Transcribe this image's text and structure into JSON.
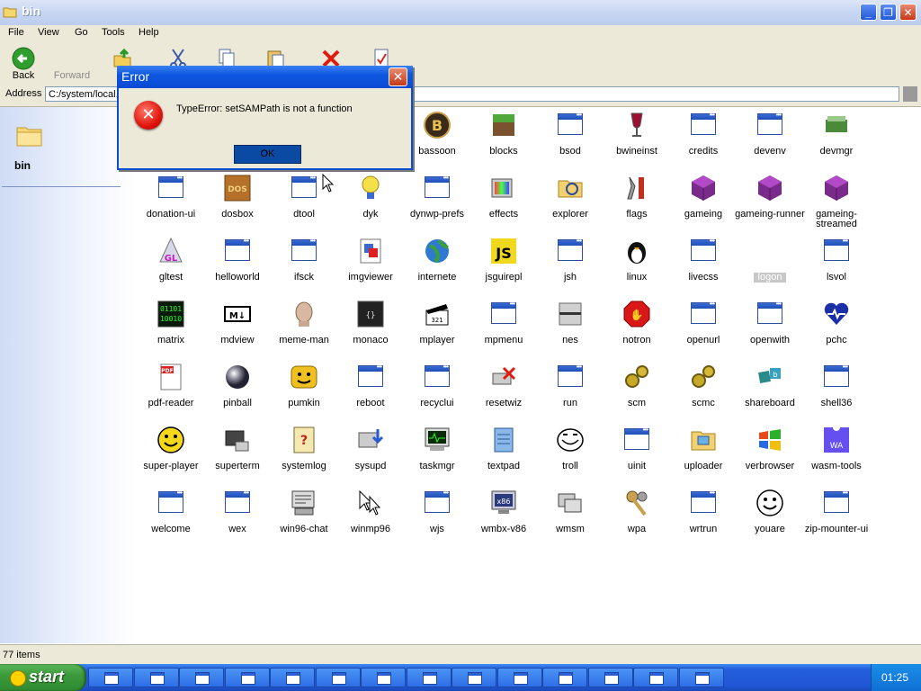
{
  "window": {
    "title": "bin",
    "controls": [
      "minimize",
      "restore",
      "close"
    ]
  },
  "menu": [
    "File",
    "View",
    "Go",
    "Tools",
    "Help"
  ],
  "toolbar": {
    "back_label": "Back",
    "forward_label": "Forward"
  },
  "address": {
    "label": "Address",
    "value": "C:/system/local."
  },
  "sidebar": {
    "folder_name": "bin"
  },
  "icons": [
    {
      "name": "bassoon",
      "icon": "bassoon-icon"
    },
    {
      "name": "blocks",
      "icon": "blocks-icon"
    },
    {
      "name": "bsod",
      "icon": "window-icon"
    },
    {
      "name": "bwineinst",
      "icon": "wine-glass-icon"
    },
    {
      "name": "credits",
      "icon": "window-icon"
    },
    {
      "name": "devenv",
      "icon": "window-icon"
    },
    {
      "name": "devmgr",
      "icon": "device-manager-icon"
    },
    {
      "name": "donation-ui",
      "icon": "window-icon"
    },
    {
      "name": "dosbox",
      "icon": "dosbox-icon"
    },
    {
      "name": "dtool",
      "icon": "window-icon"
    },
    {
      "name": "dyk",
      "icon": "lightbulb-icon"
    },
    {
      "name": "dynwp-prefs",
      "icon": "window-icon"
    },
    {
      "name": "effects",
      "icon": "effects-icon"
    },
    {
      "name": "explorer",
      "icon": "explorer-icon"
    },
    {
      "name": "flags",
      "icon": "tools-icon"
    },
    {
      "name": "gameing",
      "icon": "cube-icon"
    },
    {
      "name": "gameing-runner",
      "icon": "cube-icon"
    },
    {
      "name": "gameing-streamed",
      "icon": "cube-icon"
    },
    {
      "name": "gltest",
      "icon": "gl-cone-icon"
    },
    {
      "name": "helloworld",
      "icon": "window-icon"
    },
    {
      "name": "ifsck",
      "icon": "window-icon"
    },
    {
      "name": "imgviewer",
      "icon": "image-viewer-icon"
    },
    {
      "name": "internete",
      "icon": "globe-icon"
    },
    {
      "name": "jsguirepl",
      "icon": "js-icon"
    },
    {
      "name": "jsh",
      "icon": "window-icon"
    },
    {
      "name": "linux",
      "icon": "tux-icon"
    },
    {
      "name": "livecss",
      "icon": "window-icon"
    },
    {
      "name": "logon",
      "icon": "blank-icon",
      "selected": true
    },
    {
      "name": "lsvol",
      "icon": "window-icon"
    },
    {
      "name": "matrix",
      "icon": "matrix-icon"
    },
    {
      "name": "mdview",
      "icon": "markdown-icon"
    },
    {
      "name": "meme-man",
      "icon": "meme-man-icon"
    },
    {
      "name": "monaco",
      "icon": "monaco-icon"
    },
    {
      "name": "mplayer",
      "icon": "clapperboard-icon"
    },
    {
      "name": "mpmenu",
      "icon": "window-icon"
    },
    {
      "name": "nes",
      "icon": "nes-console-icon"
    },
    {
      "name": "notron",
      "icon": "stop-hand-icon"
    },
    {
      "name": "openurl",
      "icon": "window-icon"
    },
    {
      "name": "openwith",
      "icon": "window-icon"
    },
    {
      "name": "pchc",
      "icon": "heart-pulse-icon"
    },
    {
      "name": "pdf-reader",
      "icon": "pdf-icon"
    },
    {
      "name": "pinball",
      "icon": "pinball-icon"
    },
    {
      "name": "pumkin",
      "icon": "pumpkin-icon"
    },
    {
      "name": "reboot",
      "icon": "window-icon"
    },
    {
      "name": "recyclui",
      "icon": "window-icon"
    },
    {
      "name": "resetwiz",
      "icon": "reset-icon"
    },
    {
      "name": "run",
      "icon": "window-icon"
    },
    {
      "name": "scm",
      "icon": "cogs-icon"
    },
    {
      "name": "scmc",
      "icon": "cogs-icon"
    },
    {
      "name": "shareboard",
      "icon": "shareboard-icon"
    },
    {
      "name": "shell36",
      "icon": "window-icon"
    },
    {
      "name": "super-player",
      "icon": "smiley-icon"
    },
    {
      "name": "superterm",
      "icon": "terminal-icon"
    },
    {
      "name": "systemlog",
      "icon": "log-icon"
    },
    {
      "name": "sysupd",
      "icon": "update-icon"
    },
    {
      "name": "taskmgr",
      "icon": "task-manager-icon"
    },
    {
      "name": "textpad",
      "icon": "notepad-icon"
    },
    {
      "name": "troll",
      "icon": "trollface-icon"
    },
    {
      "name": "uinit",
      "icon": "window-icon"
    },
    {
      "name": "uploader",
      "icon": "uploader-icon"
    },
    {
      "name": "verbrowser",
      "icon": "windows-flag-icon"
    },
    {
      "name": "wasm-tools",
      "icon": "wasm-icon"
    },
    {
      "name": "welcome",
      "icon": "window-icon"
    },
    {
      "name": "wex",
      "icon": "window-icon"
    },
    {
      "name": "win96-chat",
      "icon": "chat-icon"
    },
    {
      "name": "winmp96",
      "icon": "cursor-pack-icon"
    },
    {
      "name": "wjs",
      "icon": "window-icon"
    },
    {
      "name": "wmbx-v86",
      "icon": "x86-monitor-icon"
    },
    {
      "name": "wmsm",
      "icon": "windows-stack-icon"
    },
    {
      "name": "wpa",
      "icon": "keys-icon"
    },
    {
      "name": "wrtrun",
      "icon": "window-icon"
    },
    {
      "name": "youare",
      "icon": "smiley-outline-icon"
    },
    {
      "name": "zip-mounter-ui",
      "icon": "window-icon"
    }
  ],
  "status": {
    "text": "77 items"
  },
  "taskbar": {
    "start_label": "start",
    "clock": "01:25",
    "task_count": 14
  },
  "dialog": {
    "title": "Error",
    "message": "TypeError: setSAMPath is not a function",
    "ok_label": "OK"
  },
  "colors": {
    "title_bar": "#c8d7f2",
    "taskbar": "#245edb",
    "start": "#3c9a3c",
    "selection": "#c7c7c7",
    "error_red": "#e0150c"
  }
}
